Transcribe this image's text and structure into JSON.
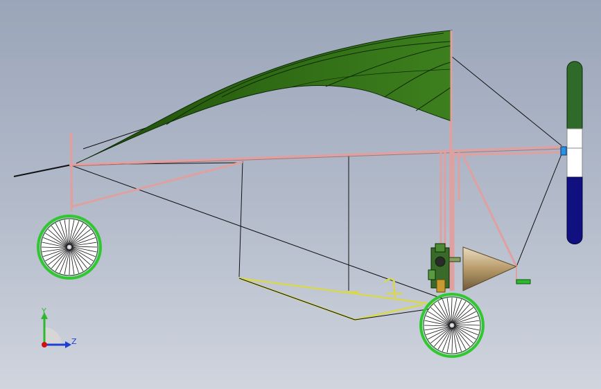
{
  "viewport": {
    "background_top": "#9aa5b9",
    "background_bottom": "#d0d5de"
  },
  "model": {
    "wing_color": "#2f6a14",
    "frame_color": "#e0a0a0",
    "skid_color": "#d8d850",
    "wheel_rim_color": "#2fc82f",
    "wire_color": "#111111",
    "propeller_colors": [
      "#2f6a2a",
      "#ffffff",
      "#101080"
    ],
    "engine_cone_color": "#c8b08a"
  },
  "triad": {
    "y_label": "Y",
    "z_label": "Z",
    "y_color": "#2fb82f",
    "z_color": "#1f3fd0",
    "x_color": "#d01010"
  }
}
